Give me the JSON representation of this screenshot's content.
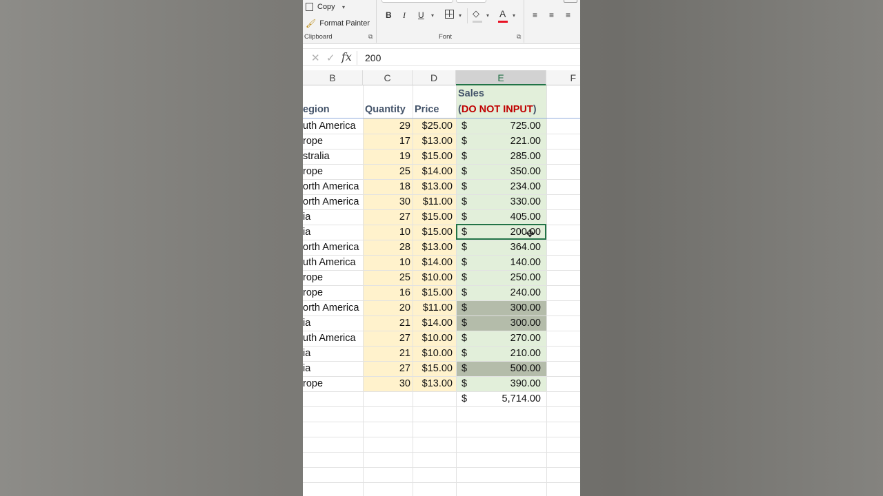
{
  "ribbon": {
    "copy_label": "Copy",
    "format_painter_label": "Format Painter",
    "clipboard_group": "Clipboard",
    "font_group": "Font",
    "bold": "B",
    "italic": "I",
    "underline": "U",
    "font_color_glyph": "A"
  },
  "formula_bar": {
    "cancel_glyph": "✕",
    "enter_glyph": "✓",
    "fx_label": "fx",
    "value": "200"
  },
  "columns": [
    "B",
    "C",
    "D",
    "E",
    "F"
  ],
  "active_column": "E",
  "header": {
    "region": "egion",
    "quantity": "Quantity",
    "price": "Price",
    "sales_line1": "Sales",
    "sales_open": "(",
    "sales_red": "DO NOT INPUT",
    "sales_close": ")"
  },
  "rows": [
    {
      "region": "uth America",
      "qty": "29",
      "price": "$25.00",
      "cur": "$",
      "sales": "725.00"
    },
    {
      "region": "rope",
      "qty": "17",
      "price": "$13.00",
      "cur": "$",
      "sales": "221.00"
    },
    {
      "region": "stralia",
      "qty": "19",
      "price": "$15.00",
      "cur": "$",
      "sales": "285.00"
    },
    {
      "region": "rope",
      "qty": "25",
      "price": "$14.00",
      "cur": "$",
      "sales": "350.00"
    },
    {
      "region": "orth America",
      "qty": "18",
      "price": "$13.00",
      "cur": "$",
      "sales": "234.00"
    },
    {
      "region": "orth America",
      "qty": "30",
      "price": "$11.00",
      "cur": "$",
      "sales": "330.00"
    },
    {
      "region": "ia",
      "qty": "27",
      "price": "$15.00",
      "cur": "$",
      "sales": "405.00"
    },
    {
      "region": "ia",
      "qty": "10",
      "price": "$15.00",
      "cur": "$",
      "sales": "200.00"
    },
    {
      "region": "orth America",
      "qty": "28",
      "price": "$13.00",
      "cur": "$",
      "sales": "364.00"
    },
    {
      "region": "uth America",
      "qty": "10",
      "price": "$14.00",
      "cur": "$",
      "sales": "140.00"
    },
    {
      "region": "rope",
      "qty": "25",
      "price": "$10.00",
      "cur": "$",
      "sales": "250.00"
    },
    {
      "region": "rope",
      "qty": "16",
      "price": "$15.00",
      "cur": "$",
      "sales": "240.00"
    },
    {
      "region": "orth America",
      "qty": "20",
      "price": "$11.00",
      "cur": "$",
      "sales": "300.00"
    },
    {
      "region": "ia",
      "qty": "21",
      "price": "$14.00",
      "cur": "$",
      "sales": "300.00"
    },
    {
      "region": "uth America",
      "qty": "27",
      "price": "$10.00",
      "cur": "$",
      "sales": "270.00"
    },
    {
      "region": "ia",
      "qty": "21",
      "price": "$10.00",
      "cur": "$",
      "sales": "210.00"
    },
    {
      "region": "ia",
      "qty": "27",
      "price": "$15.00",
      "cur": "$",
      "sales": "500.00"
    },
    {
      "region": "rope",
      "qty": "30",
      "price": "$13.00",
      "cur": "$",
      "sales": "390.00"
    }
  ],
  "highlighted_rows": [
    12,
    13,
    16
  ],
  "selected_row": 7,
  "total": {
    "cur": "$",
    "value": "5,714.00"
  },
  "colors": {
    "qty_fill": "#fff2cc",
    "sales_fill": "#e2efda",
    "highlight_fill": "#b4bcaa",
    "excel_green": "#217346",
    "header_text": "#44546a",
    "red_text": "#c00000"
  }
}
